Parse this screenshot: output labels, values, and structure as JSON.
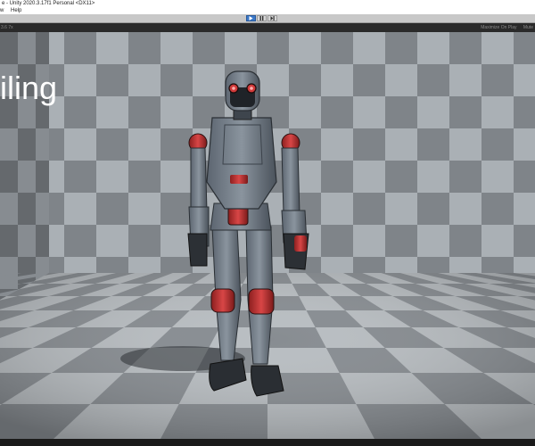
{
  "window": {
    "title": "e - Unity 2020.3.17f1 Personal <DX11>"
  },
  "menubar": {
    "items": [
      "w",
      "Help"
    ]
  },
  "toolbar": {
    "play_icon": "play-icon",
    "pause_icon": "pause-icon",
    "step_icon": "step-icon"
  },
  "game_view": {
    "aspect_label": "3.6 7x",
    "maximize_on_play": "Maximize On Play",
    "stats_prefix": "Mute",
    "overlay_text": "iling"
  },
  "colors": {
    "checker_light": "#a9aeb3",
    "checker_dark": "#7e8388",
    "accent_red": "#d03a3a",
    "play_active": "#3b78c8"
  }
}
